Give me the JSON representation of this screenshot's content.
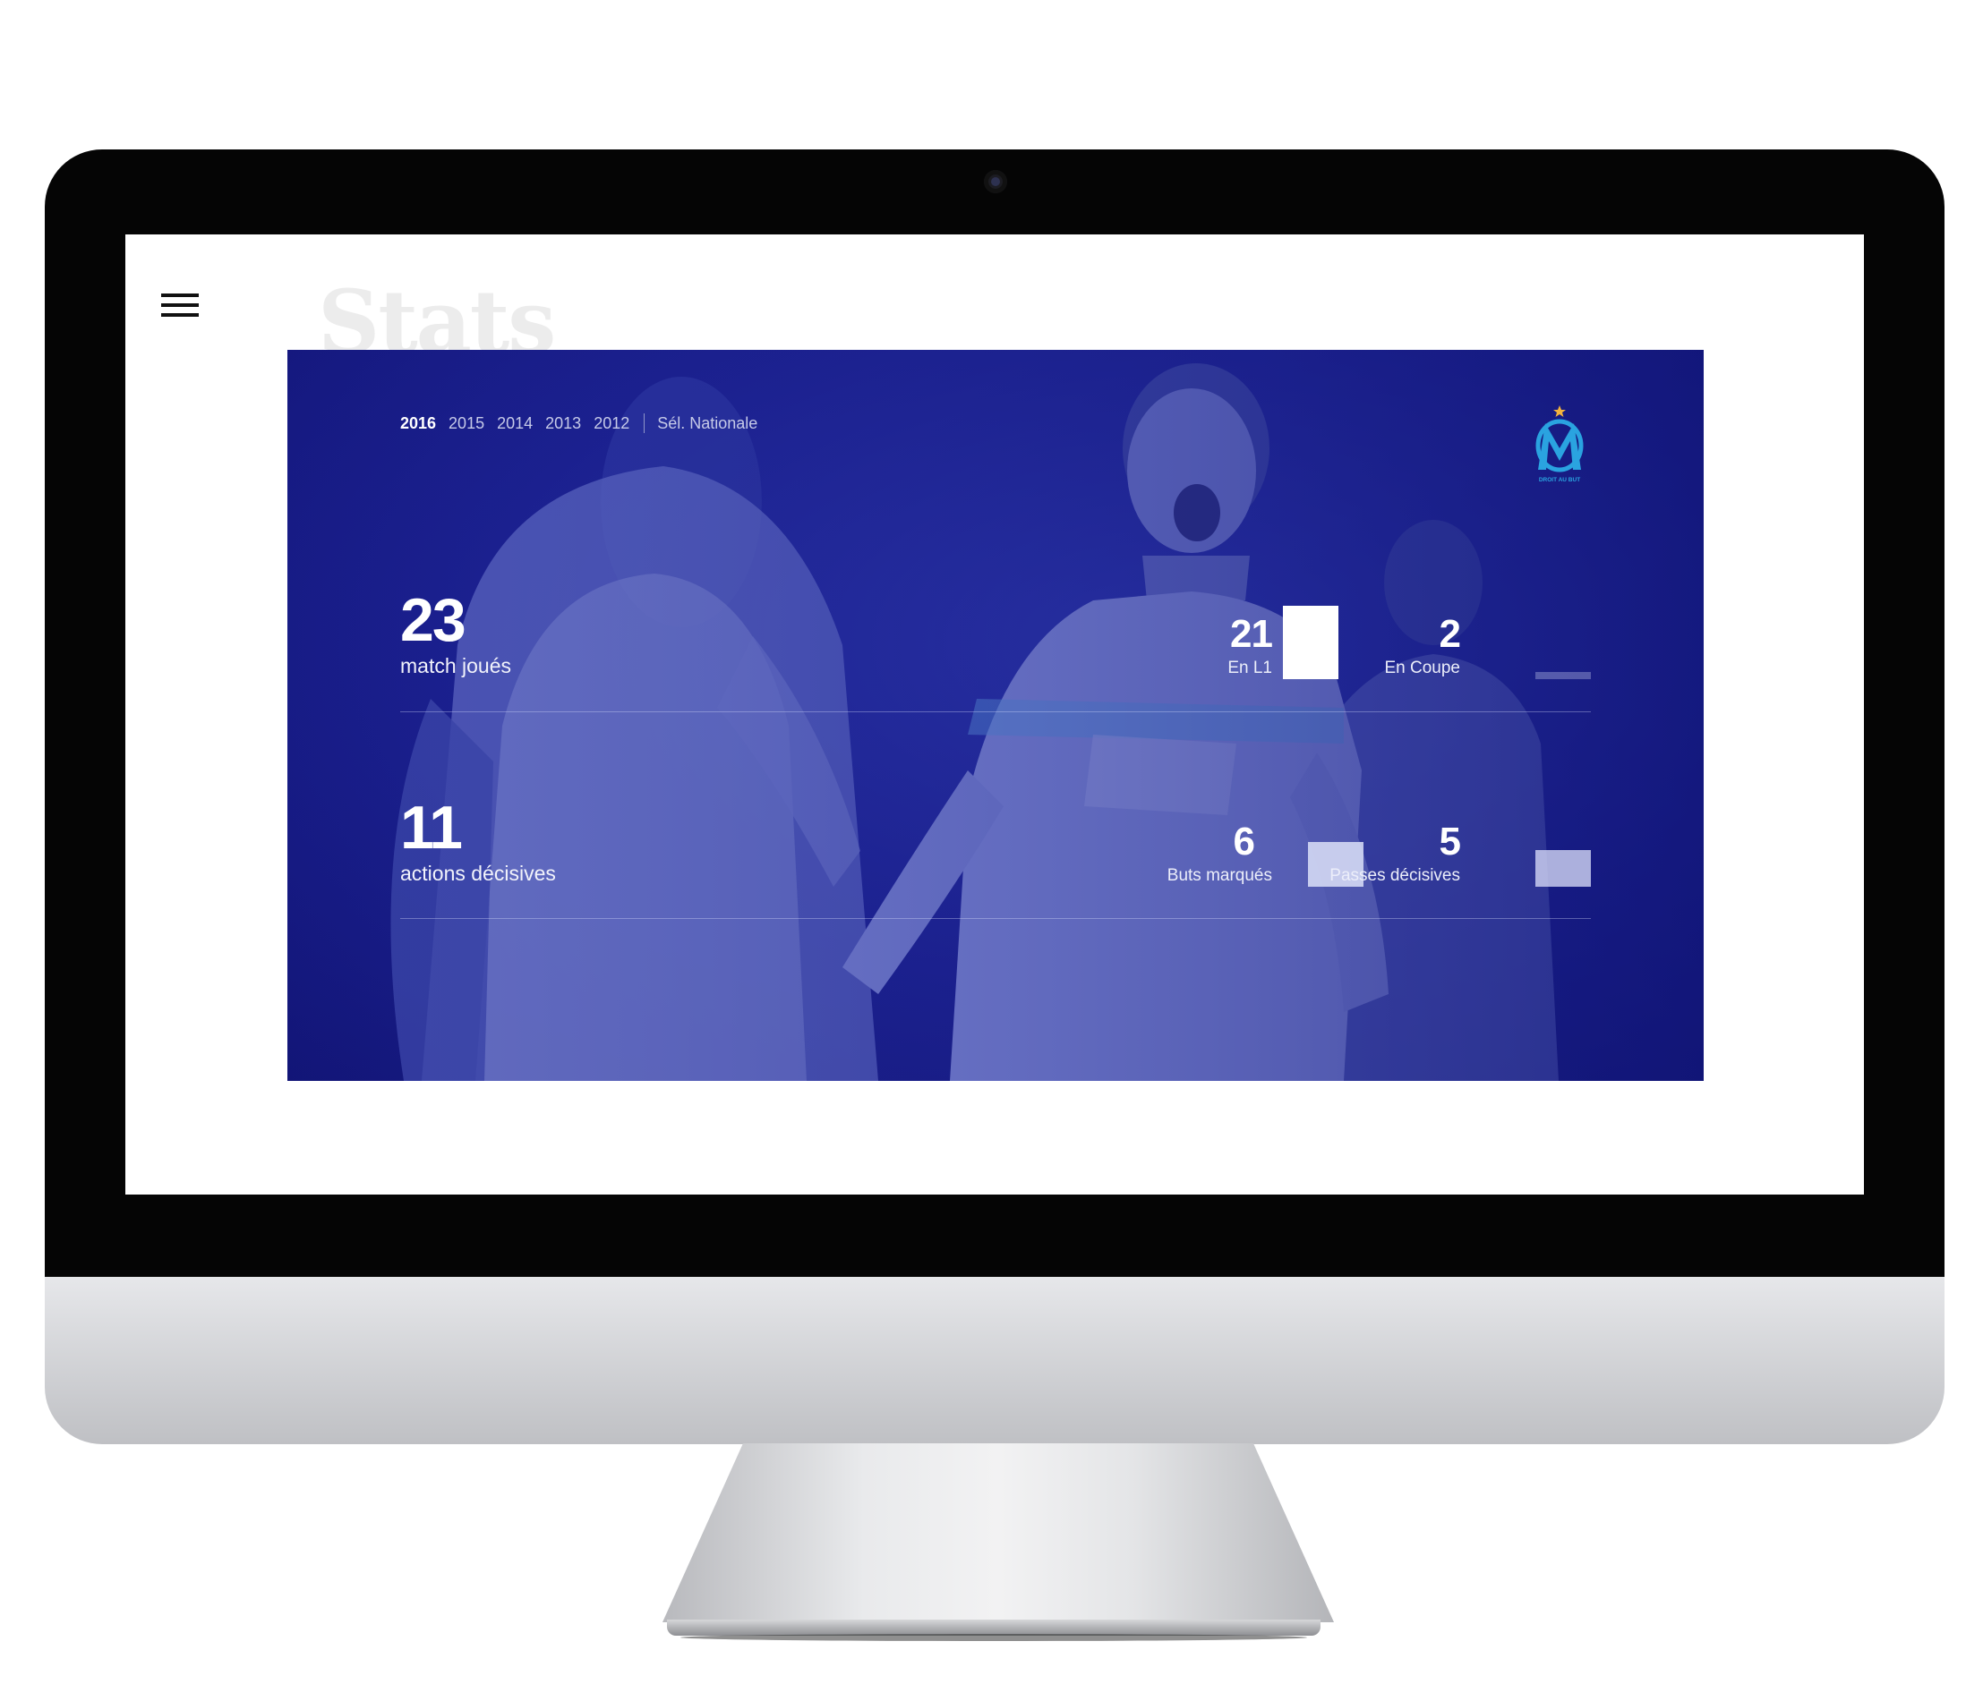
{
  "screen": {
    "title": "Stats",
    "menu_icon": "hamburger-menu-icon"
  },
  "seasons": {
    "tabs": [
      "2016",
      "2015",
      "2014",
      "2013",
      "2012"
    ],
    "active": "2016",
    "national": "Sél. Nationale"
  },
  "logo": {
    "icon": "om-crest-logo",
    "motto": "DROIT AU BUT",
    "color": "#2aa3e0"
  },
  "stats": {
    "matches": {
      "value": "23",
      "label": "match joués",
      "breakdown": [
        {
          "value": "21",
          "label": "En L1",
          "share": 0.91
        },
        {
          "value": "2",
          "label": "En Coupe",
          "share": 0.09
        }
      ]
    },
    "decisive": {
      "value": "11",
      "label": "actions décisives",
      "breakdown": [
        {
          "value": "6",
          "label": "Buts marqués",
          "share": 0.55
        },
        {
          "value": "5",
          "label": "Passes décisives",
          "share": 0.45
        }
      ]
    }
  },
  "colors": {
    "overlay": "#1a1f8e",
    "text": "#ffffff"
  }
}
